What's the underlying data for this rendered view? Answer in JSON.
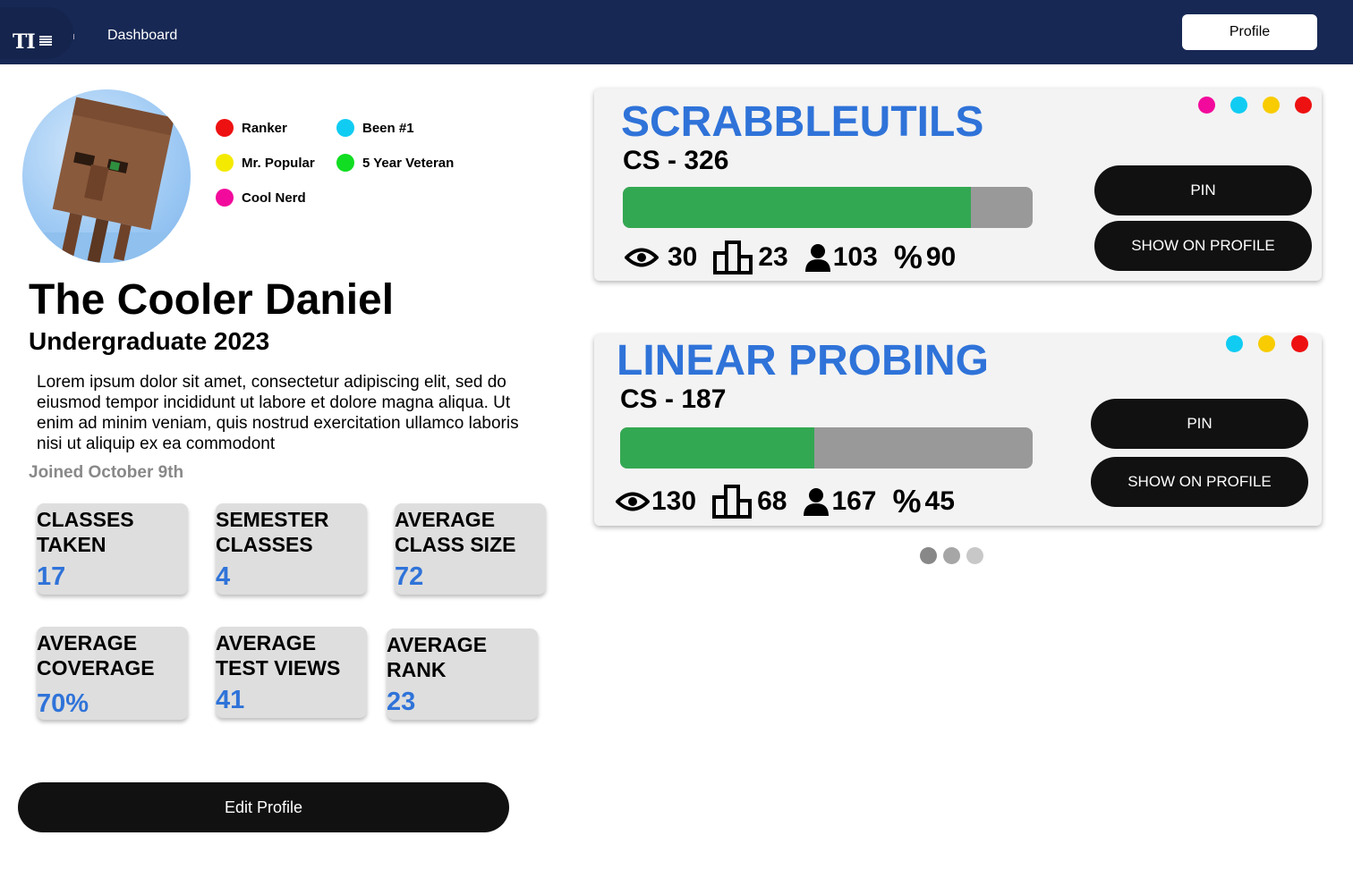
{
  "header": {
    "logo_text": "TI",
    "nav_label": "Dashboard",
    "profile_label": "Profile"
  },
  "badges": [
    {
      "label": "Ranker",
      "color": "#ee1111"
    },
    {
      "label": "Been #1",
      "color": "#11ccf2"
    },
    {
      "label": "Mr. Popular",
      "color": "#f4ea00"
    },
    {
      "label": "5 Year Veteran",
      "color": "#11dd22"
    },
    {
      "label": "Cool Nerd",
      "color": "#f20a9c"
    }
  ],
  "user": {
    "name": "The Cooler Daniel",
    "level": "Undergraduate 2023",
    "bio": "Lorem ipsum dolor sit amet, consectetur adipiscing elit, sed do eiusmod tempor incididunt ut labore et dolore magna aliqua. Ut enim ad minim veniam, quis nostrud exercitation ullamco laboris nisi ut aliquip ex ea commodont",
    "joined": "Joined October 9th"
  },
  "stats": [
    {
      "label": "CLASSES TAKEN",
      "value": "17"
    },
    {
      "label": "SEMESTER CLASSES",
      "value": "4"
    },
    {
      "label": "AVERAGE CLASS SIZE",
      "value": "72"
    },
    {
      "label": "AVERAGE COVERAGE",
      "value": "70%"
    },
    {
      "label": "AVERAGE TEST VIEWS",
      "value": "41"
    },
    {
      "label": "AVERAGE RANK",
      "value": "23"
    }
  ],
  "edit_label": "Edit Profile",
  "cards": [
    {
      "title": "SCRABBLEUTILS",
      "code": "CS - 326",
      "progress": 0.85,
      "views": "30",
      "rank": "23",
      "users": "103",
      "percent_symbol": "%",
      "percent": "90",
      "pin_label": "PIN",
      "show_label": "SHOW ON PROFILE",
      "dot_colors": [
        "#f20a9c",
        "#11ccf2",
        "#f8cc00",
        "#ee1111"
      ]
    },
    {
      "title": "LINEAR PROBING",
      "code": "CS - 187",
      "progress": 0.47,
      "views": "130",
      "rank": "68",
      "users": "167",
      "percent_symbol": "%",
      "percent": "45",
      "pin_label": "PIN",
      "show_label": "SHOW ON PROFILE",
      "dot_colors": [
        "#11ccf2",
        "#f8cc00",
        "#ee1111"
      ]
    }
  ],
  "pager_colors": [
    "#888888",
    "#a6a6a6",
    "#c8c8c8"
  ]
}
